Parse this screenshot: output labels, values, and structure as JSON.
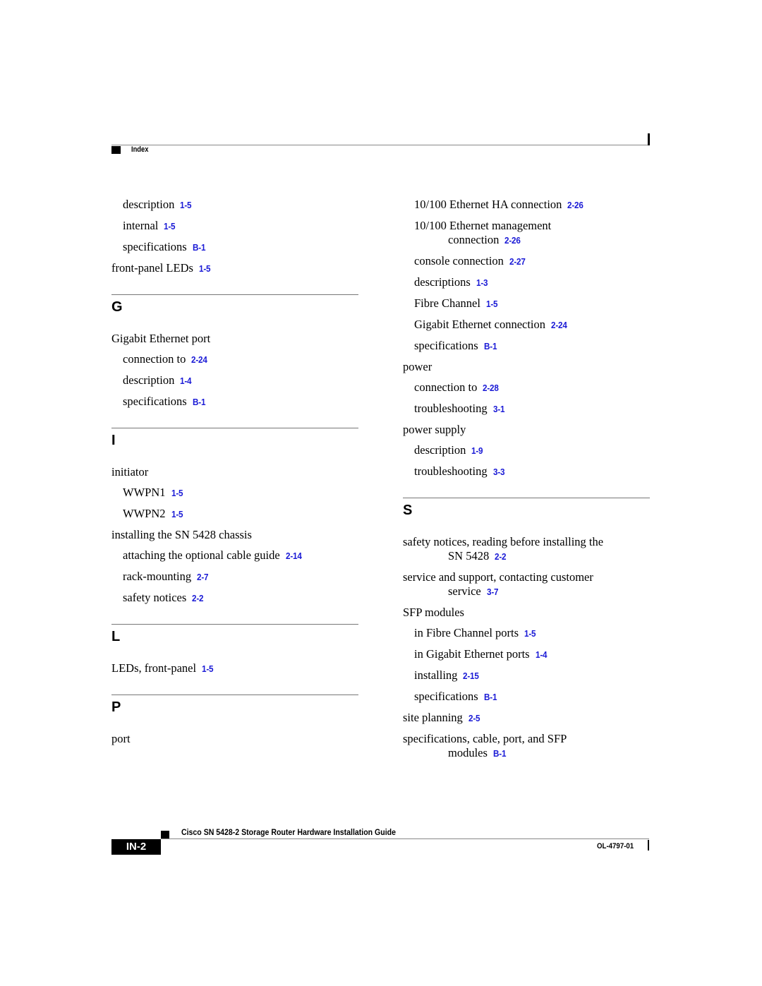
{
  "header": {
    "section_label": "Index"
  },
  "left_column": {
    "top_entries": [
      {
        "level": 1,
        "text": "description",
        "ref": "1-5"
      },
      {
        "level": 1,
        "text": "internal",
        "ref": "1-5"
      },
      {
        "level": 1,
        "text": "specifications",
        "ref": "B-1"
      },
      {
        "level": 0,
        "text": "front-panel LEDs",
        "ref": "1-5"
      }
    ],
    "sections": [
      {
        "letter": "G",
        "entries": [
          {
            "level": 0,
            "text": "Gigabit Ethernet port",
            "ref": ""
          },
          {
            "level": 1,
            "text": "connection to",
            "ref": "2-24"
          },
          {
            "level": 1,
            "text": "description",
            "ref": "1-4"
          },
          {
            "level": 1,
            "text": "specifications",
            "ref": "B-1"
          }
        ]
      },
      {
        "letter": "I",
        "entries": [
          {
            "level": 0,
            "text": "initiator",
            "ref": ""
          },
          {
            "level": 1,
            "text": "WWPN1",
            "ref": "1-5"
          },
          {
            "level": 1,
            "text": "WWPN2",
            "ref": "1-5"
          },
          {
            "level": 0,
            "text": "installing the SN 5428 chassis",
            "ref": ""
          },
          {
            "level": 1,
            "text": "attaching the optional cable guide",
            "ref": "2-14"
          },
          {
            "level": 1,
            "text": "rack-mounting",
            "ref": "2-7"
          },
          {
            "level": 1,
            "text": "safety notices",
            "ref": "2-2"
          }
        ]
      },
      {
        "letter": "L",
        "entries": [
          {
            "level": 0,
            "text": "LEDs, front-panel",
            "ref": "1-5"
          }
        ]
      },
      {
        "letter": "P",
        "entries": [
          {
            "level": 0,
            "text": "port",
            "ref": ""
          }
        ]
      }
    ]
  },
  "right_column": {
    "top_entries": [
      {
        "level": 1,
        "text": "10/100 Ethernet HA connection",
        "ref": "2-26"
      },
      {
        "level": 1,
        "text": "10/100 Ethernet management",
        "cont": "connection",
        "ref": "2-26"
      },
      {
        "level": 1,
        "text": "console connection",
        "ref": "2-27"
      },
      {
        "level": 1,
        "text": "descriptions",
        "ref": "1-3"
      },
      {
        "level": 1,
        "text": "Fibre Channel",
        "ref": "1-5"
      },
      {
        "level": 1,
        "text": "Gigabit Ethernet connection",
        "ref": "2-24"
      },
      {
        "level": 1,
        "text": "specifications",
        "ref": "B-1"
      },
      {
        "level": 0,
        "text": "power",
        "ref": ""
      },
      {
        "level": 1,
        "text": "connection to",
        "ref": "2-28"
      },
      {
        "level": 1,
        "text": "troubleshooting",
        "ref": "3-1"
      },
      {
        "level": 0,
        "text": "power supply",
        "ref": ""
      },
      {
        "level": 1,
        "text": "description",
        "ref": "1-9"
      },
      {
        "level": 1,
        "text": "troubleshooting",
        "ref": "3-3"
      }
    ],
    "sections": [
      {
        "letter": "S",
        "entries": [
          {
            "level": 0,
            "text": "safety notices, reading before installing the",
            "cont": "SN 5428",
            "ref": "2-2"
          },
          {
            "level": 0,
            "text": "service and support, contacting customer",
            "cont": "service",
            "ref": "3-7"
          },
          {
            "level": 0,
            "text": "SFP modules",
            "ref": ""
          },
          {
            "level": 1,
            "text": "in Fibre Channel ports",
            "ref": "1-5"
          },
          {
            "level": 1,
            "text": "in Gigabit Ethernet ports",
            "ref": "1-4"
          },
          {
            "level": 1,
            "text": "installing",
            "ref": "2-15"
          },
          {
            "level": 1,
            "text": "specifications",
            "ref": "B-1"
          },
          {
            "level": 0,
            "text": "site planning",
            "ref": "2-5"
          },
          {
            "level": 0,
            "text": "specifications, cable, port, and SFP",
            "cont": "modules",
            "ref": "B-1"
          }
        ]
      }
    ]
  },
  "footer": {
    "book_title": "Cisco SN 5428-2 Storage Router Hardware Installation Guide",
    "page_number": "IN-2",
    "doc_number": "OL-4797-01"
  },
  "colors": {
    "link": "#1a1ad6",
    "text": "#000000",
    "rule": "#888888"
  }
}
